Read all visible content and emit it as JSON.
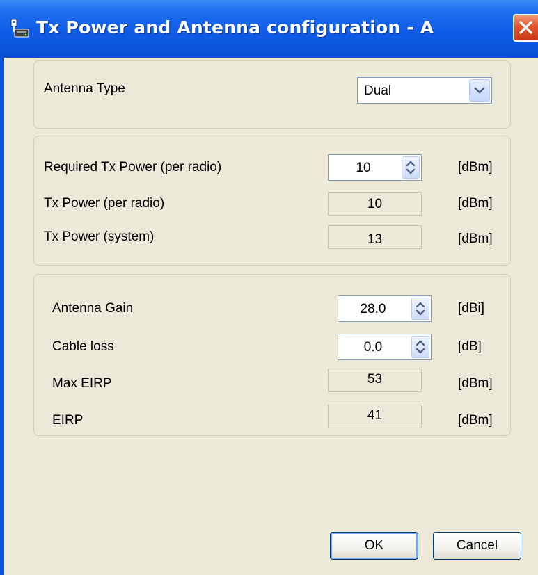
{
  "window": {
    "title": "Tx Power and Antenna configuration - A"
  },
  "antenna_type": {
    "label": "Antenna Type",
    "selected": "Dual"
  },
  "tx_power": {
    "required": {
      "label": "Required Tx Power (per radio)",
      "value": "10",
      "unit": "[dBm]"
    },
    "per_radio": {
      "label": "Tx Power (per radio)",
      "value": "10",
      "unit": "[dBm]"
    },
    "system": {
      "label": "Tx Power (system)",
      "value": "13",
      "unit": "[dBm]"
    }
  },
  "antenna": {
    "gain": {
      "label": "Antenna Gain",
      "value": "28.0",
      "unit": "[dBi]"
    },
    "cable_loss": {
      "label": "Cable loss",
      "value": "0.0",
      "unit": "[dB]"
    },
    "max_eirp": {
      "label": "Max EIRP",
      "value": "53",
      "unit": "[dBm]"
    },
    "eirp": {
      "label": "EIRP",
      "value": "41",
      "unit": "[dBm]"
    }
  },
  "buttons": {
    "ok": "OK",
    "cancel": "Cancel"
  },
  "colors": {
    "titlebar": "#0b55dc",
    "client": "#ece9d8",
    "close": "#e0532b"
  },
  "icons": {
    "title": "network-device-icon",
    "close": "close-icon",
    "combo": "chevron-down-icon",
    "spin": "spin-updown-icon"
  }
}
